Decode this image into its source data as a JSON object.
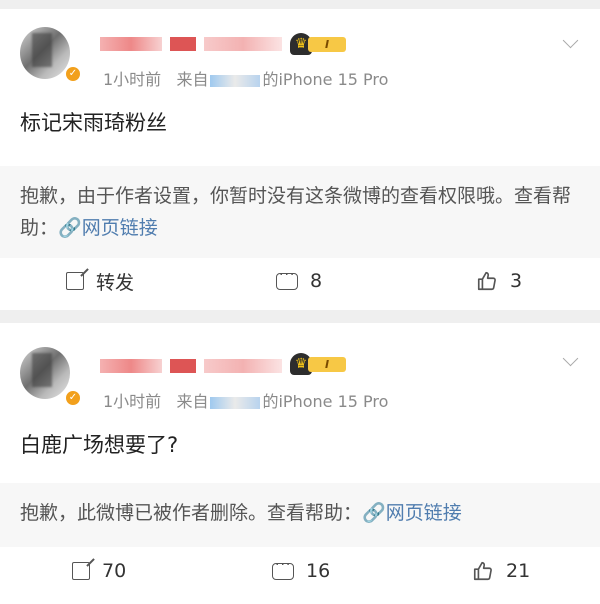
{
  "posts": [
    {
      "user_name_redacted": true,
      "level_badge": "I",
      "meta": {
        "time": "1小时前",
        "source_prefix": "来自",
        "device_suffix": "的iPhone 15 Pro"
      },
      "text": "标记宋雨琦粉丝",
      "quote": {
        "message": "抱歉，由于作者设置，你暂时没有这条微博的查看权限哦。查看帮助：",
        "link": "网页链接"
      },
      "actions": {
        "repost_label": "转发",
        "comments": "8",
        "likes": "3"
      }
    },
    {
      "user_name_redacted": true,
      "level_badge": "I",
      "meta": {
        "time": "1小时前",
        "source_prefix": "来自",
        "device_suffix": "的iPhone 15 Pro"
      },
      "text": "白鹿广场想要了?",
      "quote": {
        "message": "抱歉，此微博已被作者删除。查看帮助：",
        "link": "网页链接"
      },
      "actions": {
        "repost_count": "70",
        "comments": "16",
        "likes": "21"
      }
    }
  ],
  "colors": {
    "link": "#507daf",
    "vip_badge": "#f7c845",
    "verified": "#f2a01c"
  },
  "icons": {
    "repost": "share-icon",
    "comment": "comment-icon",
    "like": "thumbs-up-icon",
    "more": "chevron-down-icon",
    "link": "link-icon"
  }
}
